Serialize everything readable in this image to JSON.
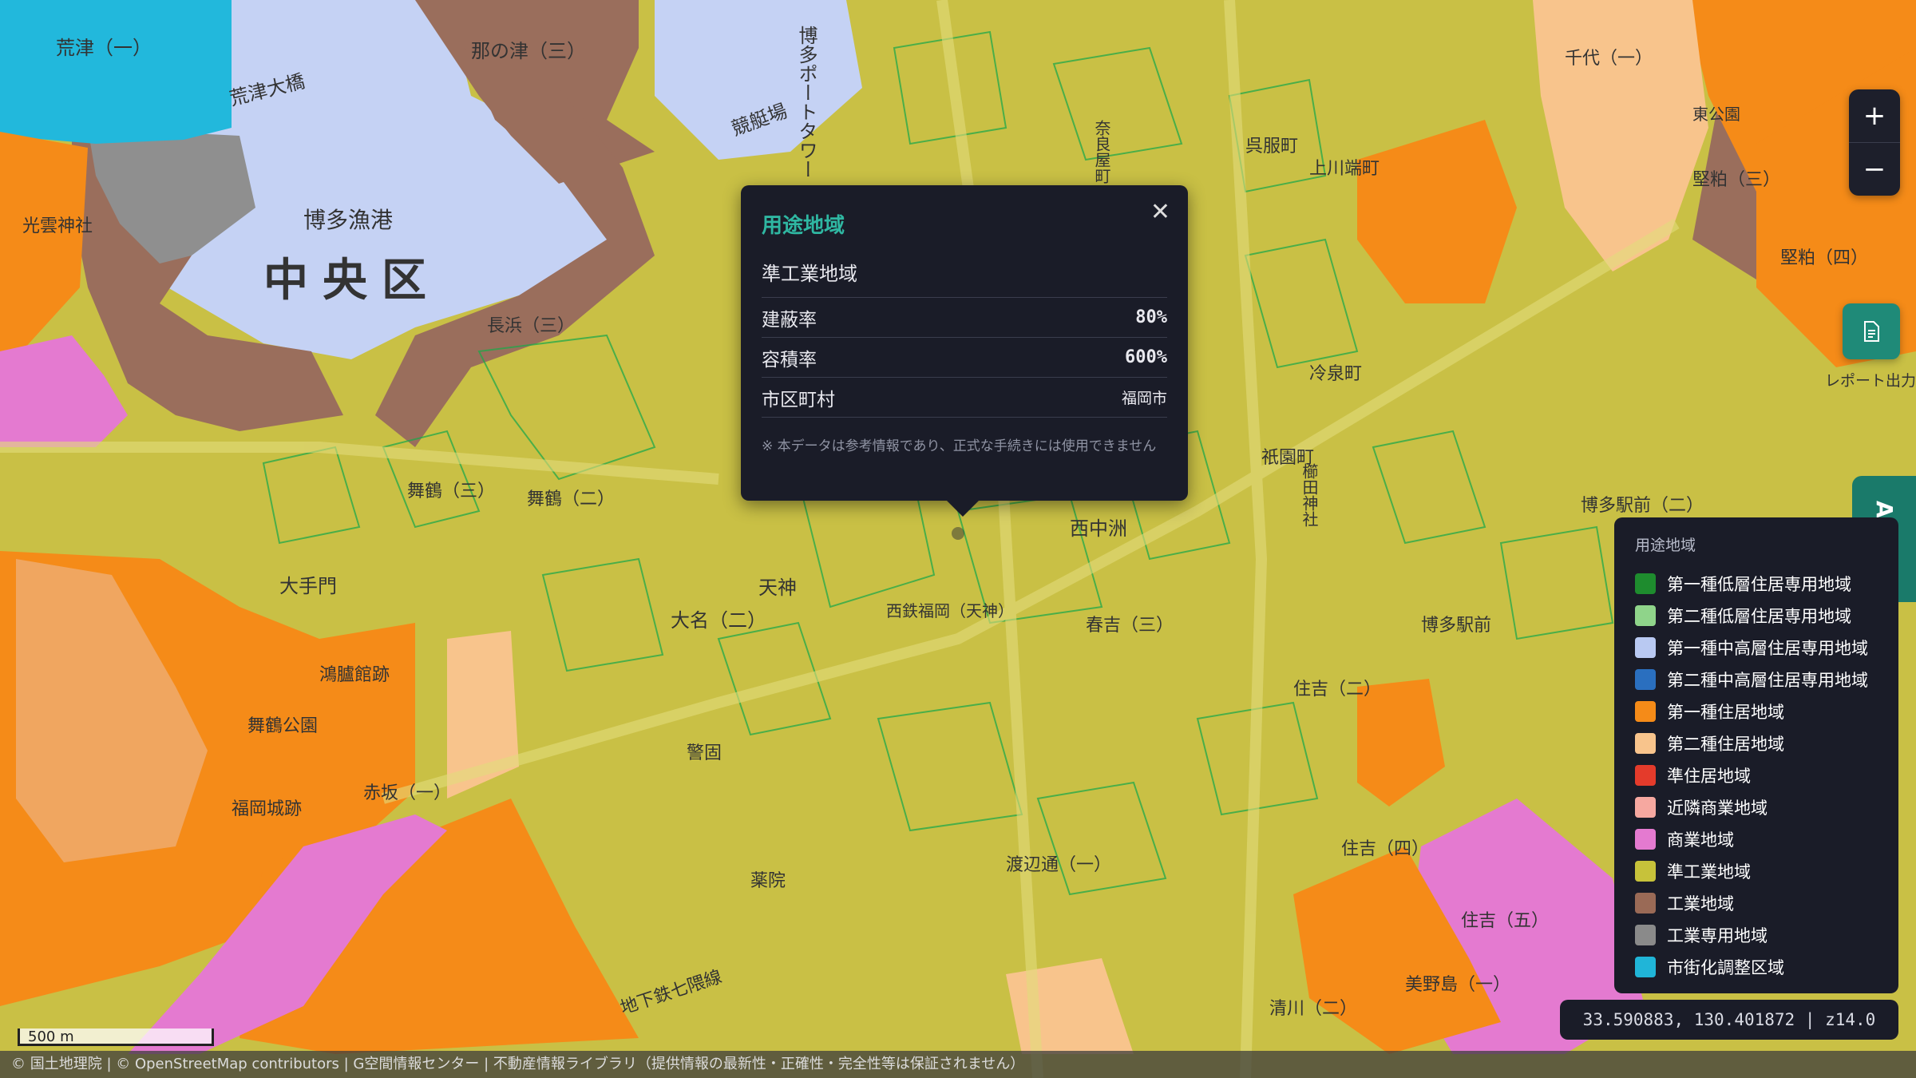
{
  "map": {
    "labels": {
      "district": "中央区",
      "fishing_port": "博多漁港",
      "aratsu": "荒津（一）",
      "aratsu_bridge": "荒津大橋",
      "nanotsu": "那の津（三）",
      "tower": "博多ポートタワー",
      "kyoteijo": "競艇場",
      "koun_shrine": "光雲神社",
      "nagahama": "長浜（三）",
      "maizuru": "舞鶴（三）",
      "maizuru2": "舞鶴（二）",
      "tenjin": "天神",
      "daimyo": "大名（二）",
      "ote": "大手門",
      "akasaka": "赤坂（一）",
      "maizuru_park": "舞鶴公園",
      "fukuoka_castle": "福岡城跡",
      "kourokan": "鴻臚館跡",
      "keigo": "警固",
      "yakuin": "薬院",
      "watanabe": "渡辺通（一）",
      "haruyoshi": "春吉（三）",
      "nakasu": "西中洲",
      "gion": "祇園町",
      "hakata_station": "博多駅前",
      "sumiyoshi": "住吉（二）",
      "minoshima": "美野島（一）",
      "kamikawabata": "上川端町",
      "reisen": "冷泉町",
      "gofukumachi": "呉服町",
      "kushida": "櫛田神社",
      "ekimae": "博多駅前（二）",
      "shimizu": "清川（二）",
      "sumiyoshi4": "住吉（四）",
      "sumiyoshi5": "住吉（五）",
      "chiyo": "千代（一）",
      "katakasu": "堅粕（三）",
      "katakasu4": "堅粕（四）",
      "nishitetsu": "西鉄福岡（天神）",
      "nanakuma": "地下鉄七隈線",
      "muromachi": "奈良屋町",
      "higashi": "東公園"
    }
  },
  "zoom": {
    "in_label": "+",
    "out_label": "−"
  },
  "report": {
    "label": "レポート出力"
  },
  "ai_tab": {
    "label": "AI対話"
  },
  "popup": {
    "title": "用途地域",
    "zone": "準工業地域",
    "rows": [
      {
        "label": "建蔽率",
        "value": "80%"
      },
      {
        "label": "容積率",
        "value": "600%"
      },
      {
        "label": "市区町村",
        "value": "福岡市"
      }
    ],
    "note": "※ 本データは参考情報であり、正式な手続きには使用できません",
    "close_label": "✕"
  },
  "legend": {
    "title": "用途地域",
    "items": [
      {
        "label": "第一種低層住居専用地域",
        "color": "#1e8c2e"
      },
      {
        "label": "第二種低層住居専用地域",
        "color": "#8fd48a"
      },
      {
        "label": "第一種中高層住居専用地域",
        "color": "#b9c9f2"
      },
      {
        "label": "第二種中高層住居専用地域",
        "color": "#2a6fbf"
      },
      {
        "label": "第一種住居地域",
        "color": "#f58b18"
      },
      {
        "label": "第二種住居地域",
        "color": "#f8c48c"
      },
      {
        "label": "準住居地域",
        "color": "#e43b2b"
      },
      {
        "label": "近隣商業地域",
        "color": "#f6a8a0"
      },
      {
        "label": "商業地域",
        "color": "#e47ad0"
      },
      {
        "label": "準工業地域",
        "color": "#c7c23a"
      },
      {
        "label": "工業地域",
        "color": "#9a6a56"
      },
      {
        "label": "工業専用地域",
        "color": "#8a8a8a"
      },
      {
        "label": "市街化調整区域",
        "color": "#20b5d8"
      }
    ]
  },
  "coords": {
    "text": "33.590883, 130.401872 | z14.0"
  },
  "scale": {
    "label": "500 m"
  },
  "attribution": {
    "text": "© 国土地理院 | © OpenStreetMap contributors | G空間情報センター | 不動産情報ライブラリ（提供情報の最新性・正確性・完全性等は保証されません）"
  }
}
